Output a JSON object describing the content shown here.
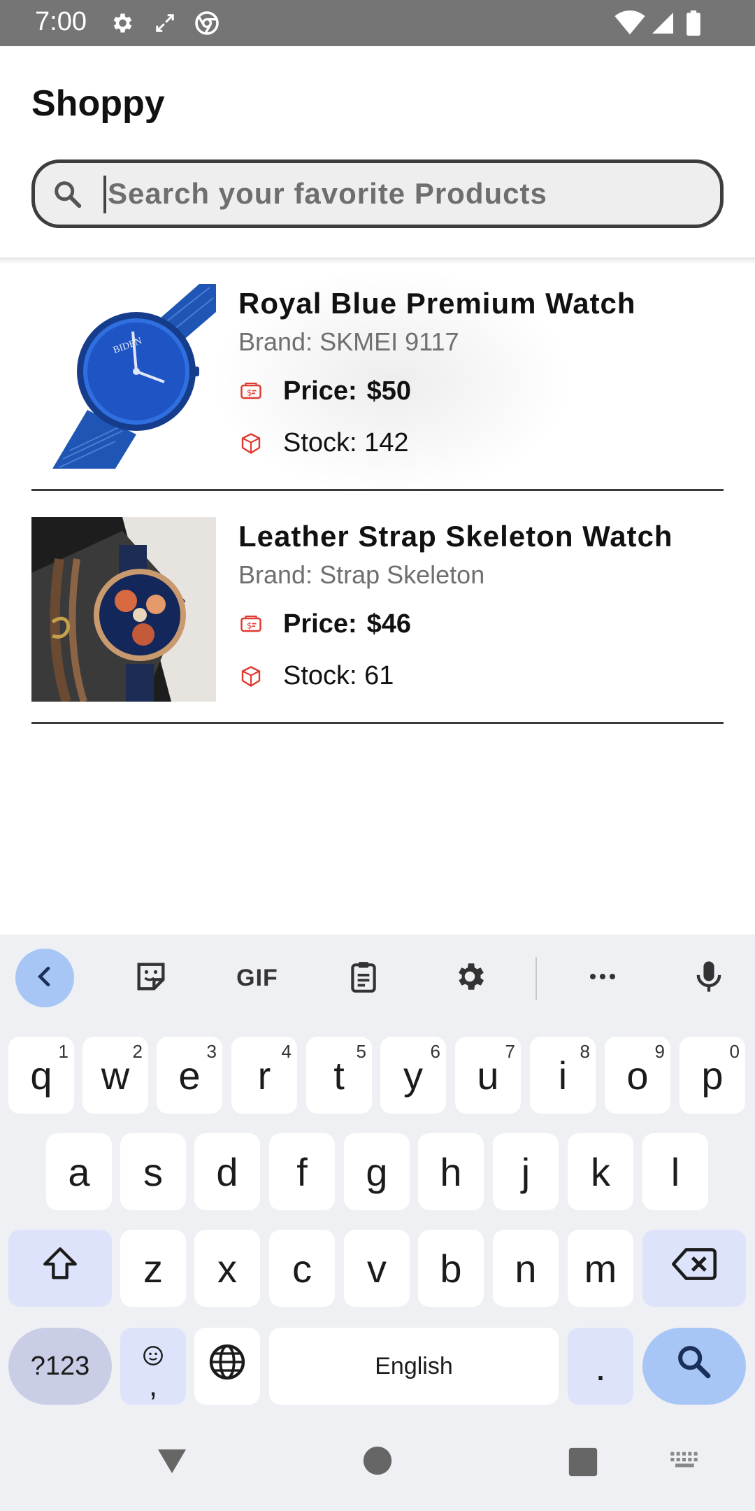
{
  "status_bar": {
    "time": "7:00",
    "left_icons": [
      "settings-icon",
      "screen-rotate-icon",
      "chrome-icon"
    ],
    "right_icons": [
      "wifi-icon",
      "cell-signal-icon",
      "battery-icon"
    ]
  },
  "app": {
    "title": "Shoppy",
    "search": {
      "placeholder": "Search your favorite Products",
      "value": ""
    }
  },
  "products": [
    {
      "title": "Royal Blue Premium Watch",
      "brand": "Brand: SKMEI 9117",
      "price_label": "Price:",
      "price": "$50",
      "stock": "Stock: 142",
      "image": "blue-mesh-watch-image"
    },
    {
      "title": "Leather Strap Skeleton Watch",
      "brand": "Brand: Strap Skeleton",
      "price_label": "Price:",
      "price": "$46",
      "stock": "Stock: 61",
      "image": "skeleton-wrist-watch-image"
    }
  ],
  "keyboard": {
    "toolbar": {
      "gif_label": "GIF"
    },
    "row1": [
      {
        "key": "q",
        "hint": "1"
      },
      {
        "key": "w",
        "hint": "2"
      },
      {
        "key": "e",
        "hint": "3"
      },
      {
        "key": "r",
        "hint": "4"
      },
      {
        "key": "t",
        "hint": "5"
      },
      {
        "key": "y",
        "hint": "6"
      },
      {
        "key": "u",
        "hint": "7"
      },
      {
        "key": "i",
        "hint": "8"
      },
      {
        "key": "o",
        "hint": "9"
      },
      {
        "key": "p",
        "hint": "0"
      }
    ],
    "row2": [
      "a",
      "s",
      "d",
      "f",
      "g",
      "h",
      "j",
      "k",
      "l"
    ],
    "row3": [
      "z",
      "x",
      "c",
      "v",
      "b",
      "n",
      "m"
    ],
    "symbols_label": "?123",
    "emoji_comma_label": ",",
    "space_label": "English",
    "period_label": "."
  },
  "colors": {
    "accent_blue": "#a8c6f5",
    "modifier_key": "#dde3fb",
    "icon_red": "#e0392f",
    "status_bar": "#757575"
  }
}
